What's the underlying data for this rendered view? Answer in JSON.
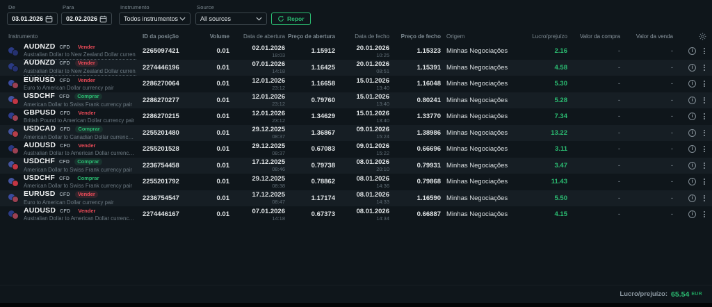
{
  "theme": {
    "background": "#0f161b",
    "row_alt": "#161e24",
    "accent_green": "#2bbd72",
    "sell_red": "#ef4b59",
    "buy_green": "#2bbd72",
    "header_text": "#7e8b93"
  },
  "filters": {
    "from_label": "De",
    "from_value": "03.01.2026",
    "to_label": "Para",
    "to_value": "02.02.2026",
    "instrument_label": "Instrumento",
    "instrument_value": "Todos instrumentos",
    "source_label": "Source",
    "source_value": "All sources",
    "reset_label": "Repor"
  },
  "table": {
    "columns": [
      "Instrumento",
      "ID da posição",
      "Volume",
      "Data de abertura",
      "Preço de abertura",
      "Data de fecho",
      "Preço de fecho",
      "Origem",
      "Lucro/prejuízo",
      "Valor da compra",
      "Valor da venda"
    ],
    "rows": [
      {
        "symbol": "AUDNZD",
        "contract": "CFD",
        "side": "Vender",
        "name": "Australian Dollar to New Zealand Dollar currency ...",
        "name_truncated": true,
        "position_id": "2265097421",
        "volume": "0.01",
        "open_date": "02.01.2026",
        "open_time": "18:03",
        "open_price": "1.15912",
        "close_date": "20.01.2026",
        "close_time": "10:25",
        "close_price": "1.15323",
        "origin": "Minhas Negociações",
        "pnl": "2.16",
        "buy_value": "-",
        "sell_value": "-",
        "icon_back": "#2a3a84",
        "icon_front": "#25316f"
      },
      {
        "symbol": "AUDNZD",
        "contract": "CFD",
        "side": "Vender",
        "name": "Australian Dollar to New Zealand Dollar currency ...",
        "name_truncated": true,
        "position_id": "2274446196",
        "volume": "0.01",
        "open_date": "07.01.2026",
        "open_time": "14:18",
        "open_price": "1.16425",
        "close_date": "20.01.2026",
        "close_time": "08:51",
        "close_price": "1.15391",
        "origin": "Minhas Negociações",
        "pnl": "4.58",
        "buy_value": "-",
        "sell_value": "-",
        "icon_back": "#2a3a84",
        "icon_front": "#25316f"
      },
      {
        "symbol": "EURUSD",
        "contract": "CFD",
        "side": "Vender",
        "name": "Euro to American Dollar currency pair",
        "name_truncated": false,
        "position_id": "2286270064",
        "volume": "0.01",
        "open_date": "12.01.2026",
        "open_time": "23:12",
        "open_price": "1.16658",
        "close_date": "15.01.2026",
        "close_time": "13:40",
        "close_price": "1.16048",
        "origin": "Minhas Negociações",
        "pnl": "5.30",
        "buy_value": "-",
        "sell_value": "-",
        "icon_back": "#3a4ba0",
        "icon_front": "#9c4052"
      },
      {
        "symbol": "USDCHF",
        "contract": "CFD",
        "side": "Comprar",
        "name": "American Dollar to Swiss Frank currency pair",
        "name_truncated": false,
        "position_id": "2286270277",
        "volume": "0.01",
        "open_date": "12.01.2026",
        "open_time": "23:12",
        "open_price": "0.79760",
        "close_date": "15.01.2026",
        "close_time": "13:40",
        "close_price": "0.80241",
        "origin": "Minhas Negociações",
        "pnl": "5.28",
        "buy_value": "-",
        "sell_value": "-",
        "icon_back": "#43539e",
        "icon_front": "#c23543"
      },
      {
        "symbol": "GBPUSD",
        "contract": "CFD",
        "side": "Vender",
        "name": "British Pound to American Dollar currency pair",
        "name_truncated": false,
        "position_id": "2286270215",
        "volume": "0.01",
        "open_date": "12.01.2026",
        "open_time": "23:12",
        "open_price": "1.34629",
        "close_date": "15.01.2026",
        "close_time": "13:40",
        "close_price": "1.33770",
        "origin": "Minhas Negociações",
        "pnl": "7.34",
        "buy_value": "-",
        "sell_value": "-",
        "icon_back": "#2e3d8e",
        "icon_front": "#9c4052"
      },
      {
        "symbol": "USDCAD",
        "contract": "CFD",
        "side": "Comprar",
        "name": "American Dollar to Canadian Dollar currency pair",
        "name_truncated": false,
        "position_id": "2255201480",
        "volume": "0.01",
        "open_date": "29.12.2025",
        "open_time": "08:37",
        "open_price": "1.36867",
        "close_date": "09.01.2026",
        "close_time": "15:24",
        "close_price": "1.38986",
        "origin": "Minhas Negociações",
        "pnl": "13.22",
        "buy_value": "-",
        "sell_value": "-",
        "icon_back": "#43539e",
        "icon_front": "#b53e49"
      },
      {
        "symbol": "AUDUSD",
        "contract": "CFD",
        "side": "Vender",
        "name": "Australian Dollar to American Dollar currency pair",
        "name_truncated": false,
        "position_id": "2255201528",
        "volume": "0.01",
        "open_date": "29.12.2025",
        "open_time": "08:37",
        "open_price": "0.67083",
        "close_date": "09.01.2026",
        "close_time": "15:22",
        "close_price": "0.66696",
        "origin": "Minhas Negociações",
        "pnl": "3.11",
        "buy_value": "-",
        "sell_value": "-",
        "icon_back": "#2a3a84",
        "icon_front": "#9c4052"
      },
      {
        "symbol": "USDCHF",
        "contract": "CFD",
        "side": "Comprar",
        "name": "American Dollar to Swiss Frank currency pair",
        "name_truncated": false,
        "position_id": "2236754458",
        "volume": "0.01",
        "open_date": "17.12.2025",
        "open_time": "08:46",
        "open_price": "0.79738",
        "close_date": "08.01.2026",
        "close_time": "20:10",
        "close_price": "0.79931",
        "origin": "Minhas Negociações",
        "pnl": "3.47",
        "buy_value": "-",
        "sell_value": "-",
        "icon_back": "#43539e",
        "icon_front": "#c23543"
      },
      {
        "symbol": "USDCHF",
        "contract": "CFD",
        "side": "Comprar",
        "name": "American Dollar to Swiss Frank currency pair",
        "name_truncated": false,
        "position_id": "2255201792",
        "volume": "0.01",
        "open_date": "29.12.2025",
        "open_time": "08:38",
        "open_price": "0.78862",
        "close_date": "08.01.2026",
        "close_time": "14:36",
        "close_price": "0.79868",
        "origin": "Minhas Negociações",
        "pnl": "11.43",
        "buy_value": "-",
        "sell_value": "-",
        "icon_back": "#43539e",
        "icon_front": "#c23543"
      },
      {
        "symbol": "EURUSD",
        "contract": "CFD",
        "side": "Vender",
        "name": "Euro to American Dollar currency pair",
        "name_truncated": false,
        "position_id": "2236754547",
        "volume": "0.01",
        "open_date": "17.12.2025",
        "open_time": "08:47",
        "open_price": "1.17174",
        "close_date": "08.01.2026",
        "close_time": "14:33",
        "close_price": "1.16590",
        "origin": "Minhas Negociações",
        "pnl": "5.50",
        "buy_value": "-",
        "sell_value": "-",
        "icon_back": "#3a4ba0",
        "icon_front": "#9c4052"
      },
      {
        "symbol": "AUDUSD",
        "contract": "CFD",
        "side": "Vender",
        "name": "Australian Dollar to American Dollar currency pair",
        "name_truncated": false,
        "position_id": "2274446167",
        "volume": "0.01",
        "open_date": "07.01.2026",
        "open_time": "14:18",
        "open_price": "0.67373",
        "close_date": "08.01.2026",
        "close_time": "14:34",
        "close_price": "0.66887",
        "origin": "Minhas Negociações",
        "pnl": "4.15",
        "buy_value": "-",
        "sell_value": "-",
        "icon_back": "#2a3a84",
        "icon_front": "#9c4052"
      }
    ]
  },
  "footer": {
    "pnl_label": "Lucro/prejuízo:",
    "pnl_value": "65.54",
    "pnl_currency": "EUR"
  }
}
